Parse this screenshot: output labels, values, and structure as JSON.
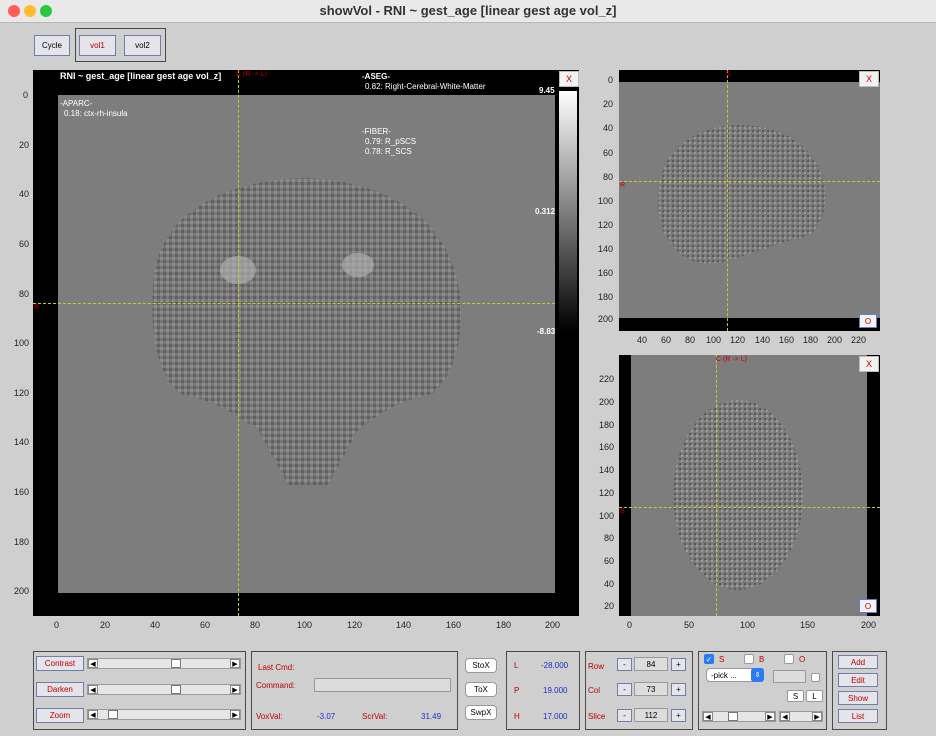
{
  "window": {
    "title": "showVol - RNI ~ gest_age [linear gest age vol_z]"
  },
  "toolbar": {
    "cycle_label": "Cycle",
    "vol1_label": "vol1",
    "vol2_label": "vol2"
  },
  "main_view": {
    "title": "RNI ~ gest_age [linear gest age vol_z]",
    "crosshair_top_label": "C (R -> L)",
    "crosshair_left_label": "R",
    "close_label": "X",
    "aseg_header": "-ASEG-",
    "aseg_value": "0.82: Right-Cerebral-White-Matter",
    "aparc_header": "-APARC-",
    "aparc_value": "0.18: ctx-rh-insula",
    "fiber_header": "-FIBER-",
    "fiber_values": [
      "0.79: R_pSCS",
      "0.78: R_SCS"
    ],
    "colorbar": {
      "max": "9.45",
      "mid": "0.312",
      "min": "-8.83"
    },
    "y_ticks": [
      "0",
      "20",
      "40",
      "60",
      "80",
      "100",
      "120",
      "140",
      "160",
      "180",
      "200"
    ],
    "x_ticks": [
      "0",
      "20",
      "40",
      "60",
      "80",
      "100",
      "120",
      "140",
      "160",
      "180",
      "200"
    ]
  },
  "sagittal_view": {
    "top_label": "S",
    "left_label": "R",
    "close_label": "X",
    "o_label": "O",
    "y_ticks": [
      "0",
      "20",
      "40",
      "60",
      "80",
      "100",
      "120",
      "140",
      "160",
      "180",
      "200"
    ],
    "x_ticks": [
      "40",
      "60",
      "80",
      "100",
      "120",
      "140",
      "160",
      "180",
      "200",
      "220"
    ]
  },
  "axial_view": {
    "top_label": "C (R -> L)",
    "left_label": "S",
    "close_label": "X",
    "o_label": "O",
    "y_ticks": [
      "220",
      "200",
      "180",
      "160",
      "140",
      "120",
      "100",
      "80",
      "60",
      "40",
      "20",
      "0"
    ],
    "x_ticks": [
      "0",
      "50",
      "100",
      "150",
      "200"
    ]
  },
  "controls": {
    "contrast_label": "Contrast",
    "darken_label": "Darken",
    "zoom_label": "Zoom",
    "contrast_level": 0.6,
    "darken_level": 0.6,
    "zoom_level": 0.08
  },
  "command_panel": {
    "last_cmd_label": "Last Cmd:",
    "command_label": "Command:",
    "voxval_label": "VoxVal:",
    "voxval": "-3.07",
    "scrval_label": "ScrVal:",
    "scrval": "31.49"
  },
  "transform_buttons": {
    "stox": "StoX",
    "tox": "ToX",
    "swpx": "SwpX"
  },
  "coords": {
    "l_label": "L",
    "l_value": "-28.000",
    "p_label": "P",
    "p_value": "19.000",
    "h_label": "H",
    "h_value": "17.000"
  },
  "navigation": {
    "row_label": "Row",
    "row_value": "84",
    "col_label": "Col",
    "col_value": "73",
    "slice_label": "Slice",
    "slice_value": "112",
    "minus": "-",
    "plus": "+"
  },
  "overlay_panel": {
    "s_label": "S",
    "b_label": "B",
    "o_label": "O",
    "pick_label": "-pick ...",
    "s_btn": "S",
    "l_btn": "L"
  },
  "actions": {
    "add": "Add",
    "edit": "Edit",
    "show": "Show",
    "list": "List"
  },
  "colors": {
    "accent_red": "#c00000",
    "value_blue": "#1c2fc9",
    "crosshair": "#c8c832"
  }
}
